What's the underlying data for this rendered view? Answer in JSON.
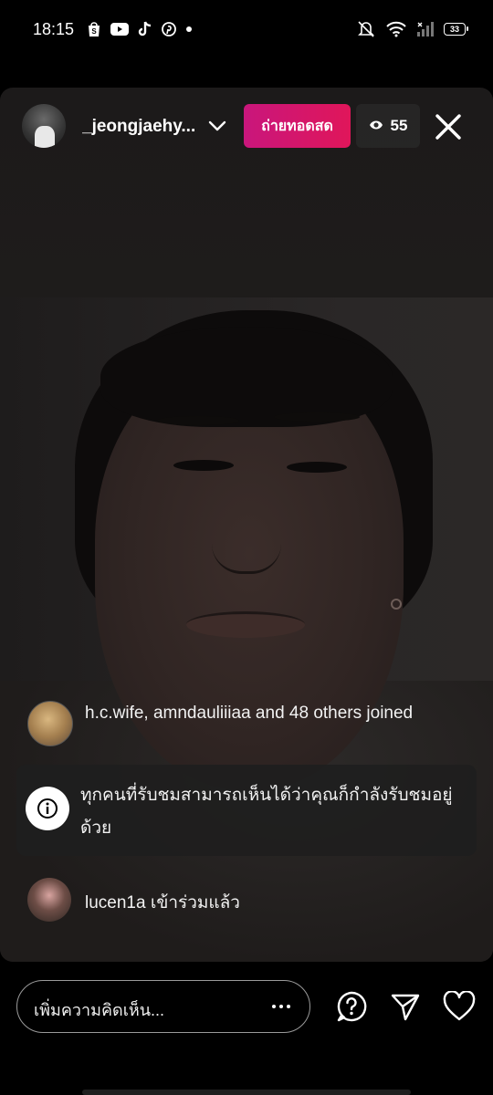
{
  "status_bar": {
    "time": "18:15",
    "battery": "33",
    "left_icons": [
      "shopee-icon",
      "youtube-icon",
      "tiktok-icon",
      "pinterest-icon",
      "dot-icon"
    ],
    "right_icons": [
      "mute-icon",
      "wifi-icon",
      "signal-icon",
      "battery-icon"
    ]
  },
  "live": {
    "host_username": "_jeongjaehy...",
    "live_label": "ถ่ายทอดสด",
    "viewer_count": "55"
  },
  "comments": {
    "joined_summary": "h.c.wife, amndauliiiaa and 48 others joined",
    "notice_text": "ทุกคนที่รับชมสามารถเห็นได้ว่าคุณก็กำลังรับชมอยู่ด้วย",
    "joined_user": "lucen1a เข้าร่วมแล้ว"
  },
  "composer": {
    "placeholder": "เพิ่มความคิดเห็น..."
  },
  "colors": {
    "live_gradient_start": "#c9167c",
    "live_gradient_end": "#e0165a",
    "background": "#000000"
  }
}
